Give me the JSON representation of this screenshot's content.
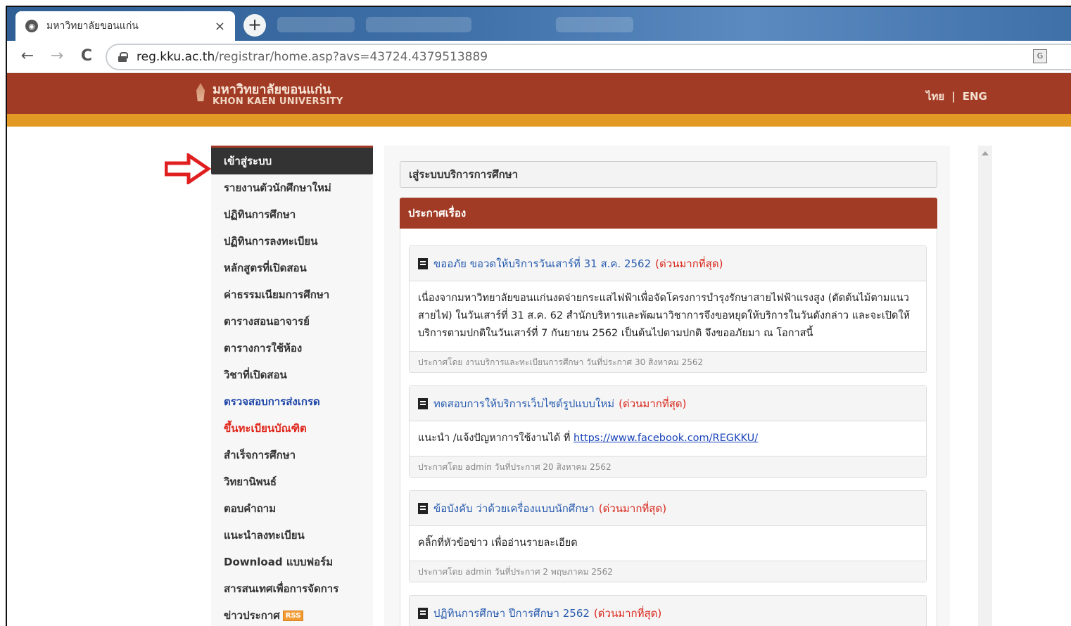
{
  "browser": {
    "tab_title": "มหาวิทยาลัยขอนแก่น",
    "tab_close": "×",
    "new_tab": "+",
    "back": "←",
    "forward": "→",
    "reload": "C",
    "url_host": "reg.kku.ac.th",
    "url_path": "/registrar/home.asp?avs=43724.4379513889",
    "translate": "G"
  },
  "header": {
    "logo_th": "มหาวิทยาลัยขอนแก่น",
    "logo_en": "KHON KAEN UNIVERSITY",
    "lang_th": "ไทย",
    "lang_sep": "|",
    "lang_en": "ENG"
  },
  "sidebar": {
    "items": [
      {
        "label": "เข้าสู่ระบบ"
      },
      {
        "label": "รายงานตัวนักศึกษาใหม่"
      },
      {
        "label": "ปฏิทินการศึกษา"
      },
      {
        "label": "ปฏิทินการลงทะเบียน"
      },
      {
        "label": "หลักสูตรที่เปิดสอน"
      },
      {
        "label": "ค่าธรรมเนียมการศึกษา"
      },
      {
        "label": "ตารางสอนอาจารย์"
      },
      {
        "label": "ตารางการใช้ห้อง"
      },
      {
        "label": "วิชาที่เปิดสอน"
      },
      {
        "label": "ตรวจสอบการส่งเกรด"
      },
      {
        "label": "ขึ้นทะเบียนบัณฑิต"
      },
      {
        "label": "สำเร็จการศึกษา"
      },
      {
        "label": "วิทยานิพนธ์"
      },
      {
        "label": "ตอบคำถาม"
      },
      {
        "label": "แนะนำลงทะเบียน"
      },
      {
        "label": "Download แบบฟอร์ม"
      },
      {
        "label": "สารสนเทศเพื่อการจัดการ"
      },
      {
        "label": "ข่าวประกาศ"
      }
    ],
    "rss_badge": "RSS"
  },
  "main": {
    "breadcrumb": "เสู่ระบบบริการการศึกษา",
    "announce_title": "ประกาศเรื่อง",
    "cards": [
      {
        "title": "ขออภัย ขอวดให้บริการวันเสาร์ที่ 31 ส.ค. 2562",
        "urgent": "(ด่วนมากที่สุด)",
        "body": "เนื่องจากมหาวิทยาลัยขอนแก่นงดจ่ายกระแสไฟฟ้าเพื่อจัดโครงการบำรุงรักษาสายไฟฟ้าแรงสูง (ตัดต้นไม้ตามแนวสายไฟ) ในวันเสาร์ที่ 31 ส.ค. 62 สำนักบริหารและพัฒนาวิชาการจึงขอหยุดให้บริการในวันดังกล่าว และจะเปิดให้บริการตามปกติในวันเสาร์ที่ 7 กันยายน 2562 เป็นต้นไปตามปกติ จึงขออภัยมา ณ โอกาสนี้",
        "footer": "ประกาศโดย งานบริการและทะเบียนการศึกษา วันที่ประกาศ 30 สิงหาคม 2562"
      },
      {
        "title": "ทดสอบการให้บริการเว็บไซต์รูปแบบใหม่",
        "urgent": "(ด่วนมากที่สุด)",
        "body_prefix": "แนะนำ /แจ้งปัญหาการใช้งานได้ ที่",
        "body_link": "https://www.facebook.com/REGKKU/",
        "footer": "ประกาศโดย admin วันที่ประกาศ 20 สิงหาคม 2562"
      },
      {
        "title": "ข้อบังคับ ว่าด้วยเครื่องแบบนักศึกษา",
        "urgent": "(ด่วนมากที่สุด)",
        "body": "คลิ๊กที่หัวข้อข่าว เพื่ออ่านรายละเอียด",
        "footer": "ประกาศโดย admin วันที่ประกาศ 2 พฤษภาคม 2562"
      },
      {
        "title": "ปฏิทินการศึกษา ปีการศึกษา 2562",
        "urgent": "(ด่วนมากที่สุด)"
      }
    ]
  },
  "colors": {
    "header_red": "#a23b25",
    "strip_orange": "#e39a25",
    "active_item": "#333333",
    "blue_item": "#1d44a6",
    "red_item": "#e0261b",
    "arrow_red": "#e02020"
  }
}
